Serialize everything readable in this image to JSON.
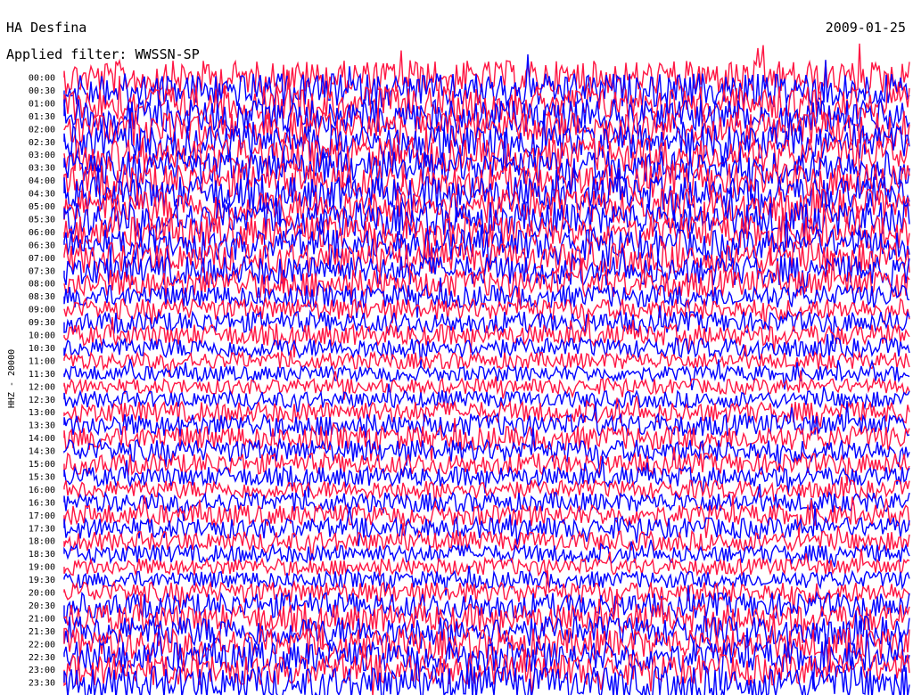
{
  "header": {
    "station": "HA Desfina",
    "date": "2009-01-25",
    "filter": "Applied filter: WWSSN-SP"
  },
  "chart_data": {
    "type": "line",
    "title": "HA Desfina",
    "subtitle": "Applied filter: WWSSN-SP",
    "date": "2009-01-25",
    "ylabel": "HHZ - 20000",
    "xlabel": "",
    "series_colors": [
      "#ff1744",
      "#0000ff"
    ],
    "rows": [
      "00:00",
      "00:30",
      "01:00",
      "01:30",
      "02:00",
      "02:30",
      "03:00",
      "03:30",
      "04:00",
      "04:30",
      "05:00",
      "05:30",
      "06:00",
      "06:30",
      "07:00",
      "07:30",
      "08:00",
      "08:30",
      "09:00",
      "09:30",
      "10:00",
      "10:30",
      "11:00",
      "11:30",
      "12:00",
      "12:30",
      "13:00",
      "13:30",
      "14:00",
      "14:30",
      "15:00",
      "15:30",
      "16:00",
      "16:30",
      "17:00",
      "17:30",
      "18:00",
      "18:30",
      "19:00",
      "19:30",
      "20:00",
      "20:30",
      "21:00",
      "21:30",
      "22:00",
      "22:30",
      "23:00",
      "23:30"
    ],
    "noise_level": [
      1.0,
      1.0,
      1.0,
      1.0,
      1.0,
      1.0,
      1.0,
      1.0,
      1.0,
      1.0,
      1.0,
      1.0,
      0.95,
      0.9,
      0.9,
      0.85,
      0.8,
      0.6,
      0.55,
      0.55,
      0.55,
      0.5,
      0.4,
      0.35,
      0.35,
      0.4,
      0.55,
      0.6,
      0.65,
      0.6,
      0.55,
      0.5,
      0.45,
      0.5,
      0.55,
      0.55,
      0.5,
      0.45,
      0.4,
      0.4,
      0.55,
      0.7,
      0.8,
      0.85,
      0.9,
      0.9,
      0.9,
      1.0
    ],
    "grid": false,
    "legend": "none"
  }
}
